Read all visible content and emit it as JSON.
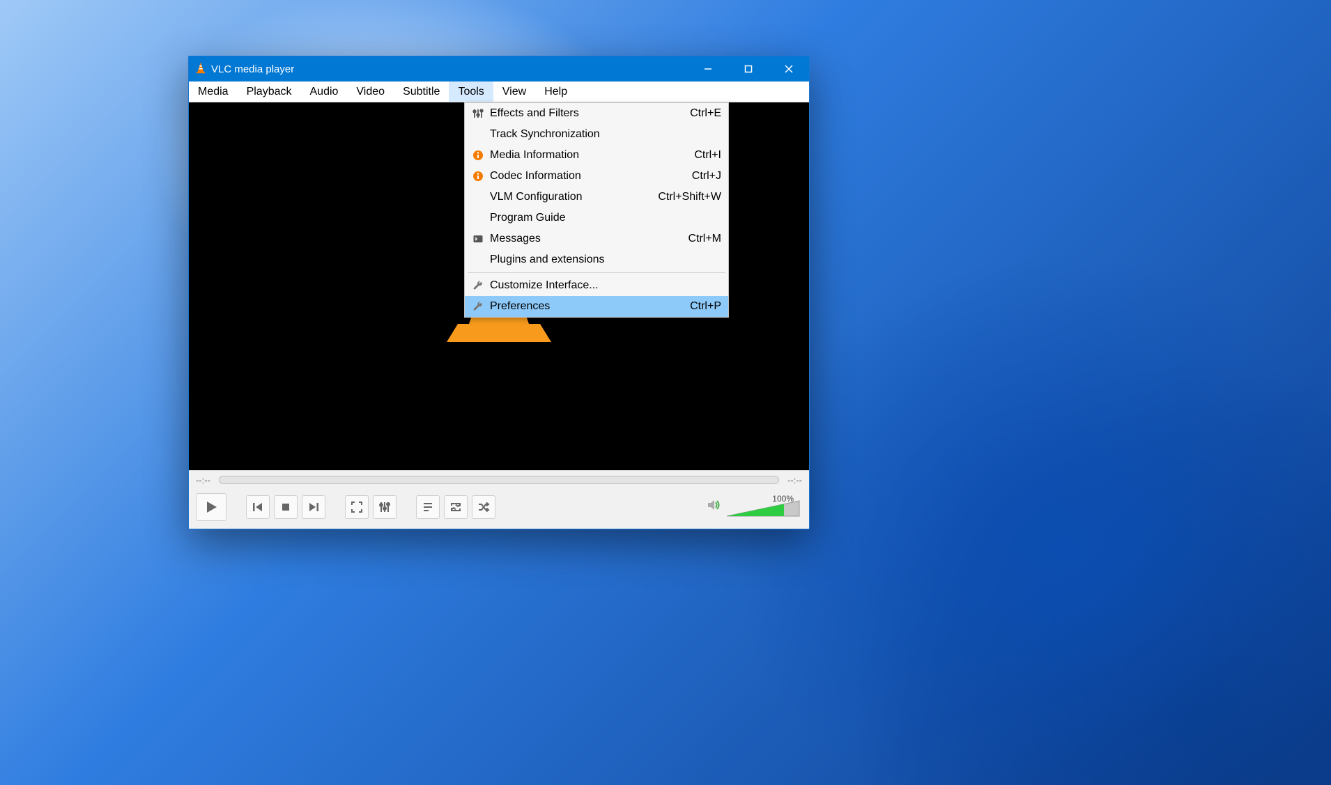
{
  "window": {
    "title": "VLC media player"
  },
  "menubar": {
    "media": "Media",
    "playback": "Playback",
    "audio": "Audio",
    "video": "Video",
    "subtitle": "Subtitle",
    "tools": "Tools",
    "view": "View",
    "help": "Help"
  },
  "tools_menu": {
    "effects": {
      "label": "Effects and Filters",
      "shortcut": "Ctrl+E"
    },
    "tracksync": {
      "label": "Track Synchronization",
      "shortcut": ""
    },
    "mediainfo": {
      "label": "Media Information",
      "shortcut": "Ctrl+I"
    },
    "codecinfo": {
      "label": "Codec Information",
      "shortcut": "Ctrl+J"
    },
    "vlm": {
      "label": "VLM Configuration",
      "shortcut": "Ctrl+Shift+W"
    },
    "guide": {
      "label": "Program Guide",
      "shortcut": ""
    },
    "messages": {
      "label": "Messages",
      "shortcut": "Ctrl+M"
    },
    "plugins": {
      "label": "Plugins and extensions",
      "shortcut": ""
    },
    "customize": {
      "label": "Customize Interface...",
      "shortcut": ""
    },
    "preferences": {
      "label": "Preferences",
      "shortcut": "Ctrl+P"
    }
  },
  "playback": {
    "elapsed": "--:--",
    "remaining": "--:--",
    "volume_label": "100%"
  }
}
